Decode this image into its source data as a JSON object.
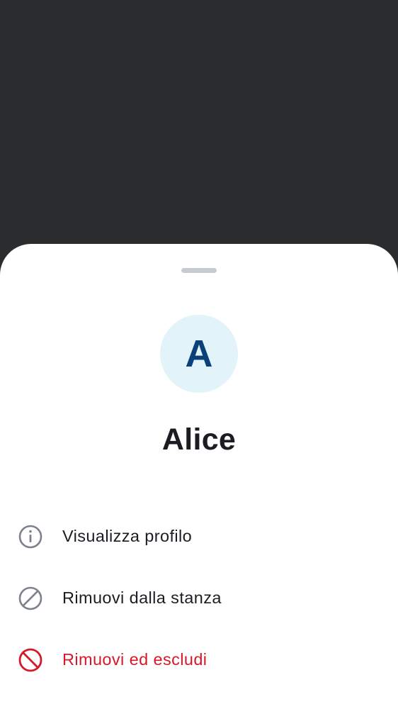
{
  "user": {
    "avatar_initial": "A",
    "display_name": "Alice"
  },
  "actions": [
    {
      "label": "Visualizza profilo",
      "icon": "info-icon",
      "color": "#1b1d22"
    },
    {
      "label": "Rimuovi dalla stanza",
      "icon": "block-icon",
      "color": "#1b1d22"
    },
    {
      "label": "Rimuovi ed escludi",
      "icon": "ban-icon",
      "color": "#d51928"
    }
  ],
  "colors": {
    "scrim": "#2b2c2e",
    "sheet": "#ffffff",
    "avatar_bg": "#e2f3fa",
    "avatar_text": "#0b4178",
    "danger": "#d51928",
    "icon_gray": "#7c828d"
  }
}
